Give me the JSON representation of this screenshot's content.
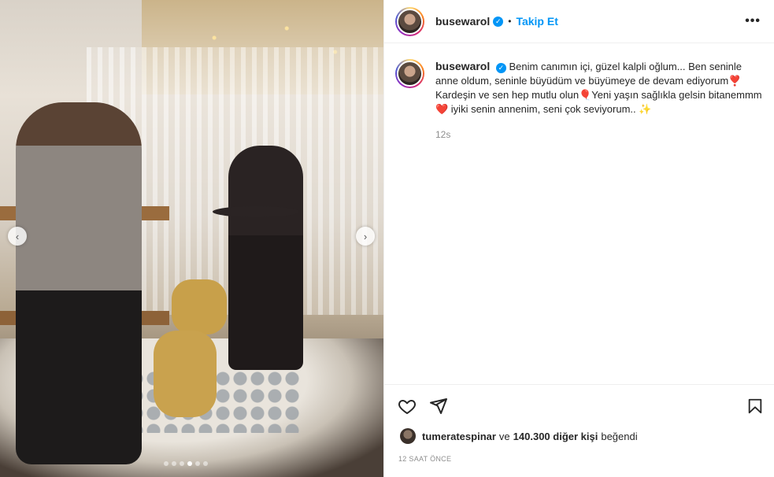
{
  "post": {
    "username": "busewarol",
    "follow_label": "Takip Et",
    "separator": "•",
    "more_label": "•••",
    "caption": "Benim canımın içi, güzel kalpli oğlum... Ben seninle anne oldum, seninle büyüdüm ve büyümeye de devam ediyorum❣️ Kardeşin ve sen hep mutlu olun🎈Yeni yaşın sağlıkla gelsin bitanemmm❤️ iyiki senin annenim, seni çok seviyorum.. ✨",
    "time_ago": "12s",
    "liked_by_user": "tumeratespinar",
    "likes_connector": "ve",
    "likes_others": "140.300 diğer kişi",
    "likes_suffix": "beğendi",
    "date_label": "12 SAAT ÖNCE"
  },
  "media": {
    "prev_icon": "‹",
    "next_icon": "›",
    "dots_total": 6,
    "dots_active": 3
  },
  "colors": {
    "accent": "#0095f6",
    "text": "#262626",
    "muted": "#8e8e8e"
  }
}
